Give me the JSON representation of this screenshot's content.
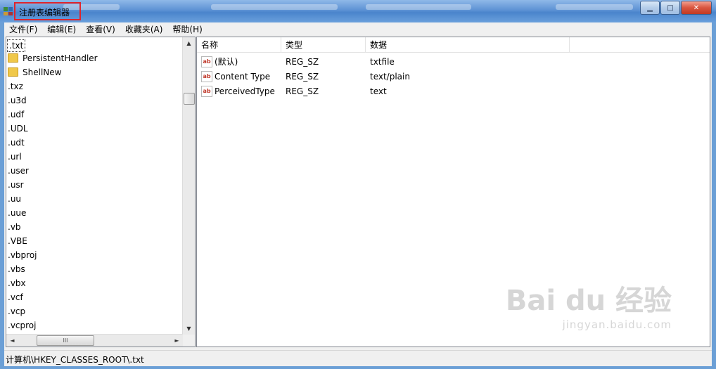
{
  "window": {
    "title": "注册表编辑器",
    "buttons": {
      "minimize": "▁",
      "maximize": "□",
      "close": "✕"
    }
  },
  "menu": [
    "文件(F)",
    "编辑(E)",
    "查看(V)",
    "收藏夹(A)",
    "帮助(H)"
  ],
  "tree": {
    "items": [
      {
        "label": ".txt",
        "selected": true,
        "folder": false
      },
      {
        "label": "PersistentHandler",
        "folder": true
      },
      {
        "label": "ShellNew",
        "folder": true
      },
      {
        "label": ".txz"
      },
      {
        "label": ".u3d"
      },
      {
        "label": ".udf"
      },
      {
        "label": ".UDL"
      },
      {
        "label": ".udt"
      },
      {
        "label": ".url"
      },
      {
        "label": ".user"
      },
      {
        "label": ".usr"
      },
      {
        "label": ".uu"
      },
      {
        "label": ".uue"
      },
      {
        "label": ".vb"
      },
      {
        "label": ".VBE"
      },
      {
        "label": ".vbproj"
      },
      {
        "label": ".vbs"
      },
      {
        "label": ".vbx"
      },
      {
        "label": ".vcf"
      },
      {
        "label": ".vcp"
      },
      {
        "label": ".vcproj"
      }
    ],
    "scroll_up": "▲",
    "scroll_down": "▼",
    "scroll_left": "◄",
    "scroll_right": "►",
    "hthumb_grip": "III"
  },
  "list": {
    "columns": [
      "名称",
      "类型",
      "数据"
    ],
    "rows": [
      {
        "icon": "ab",
        "name": "(默认)",
        "type": "REG_SZ",
        "data": "txtfile"
      },
      {
        "icon": "ab",
        "name": "Content Type",
        "type": "REG_SZ",
        "data": "text/plain"
      },
      {
        "icon": "ab",
        "name": "PerceivedType",
        "type": "REG_SZ",
        "data": "text"
      }
    ]
  },
  "statusbar": {
    "path": "计算机\\HKEY_CLASSES_ROOT\\.txt"
  },
  "watermark": {
    "main": "Bai du 经验",
    "sub": "jingyan.baidu.com"
  }
}
